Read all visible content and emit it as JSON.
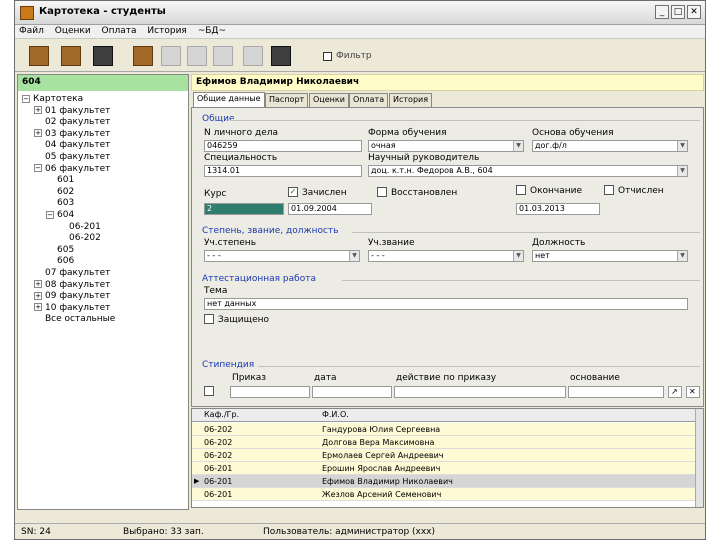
{
  "window": {
    "title": "Картотека - студенты"
  },
  "menu": [
    "Файл",
    "Оценки",
    "Оплата",
    "История",
    "~БД~"
  ],
  "toolbar": {
    "filter_label": "Фильтр"
  },
  "left": {
    "header": "604",
    "tree": [
      {
        "label": "Картотека",
        "level": 0,
        "exp": "-"
      },
      {
        "label": "01 факультет",
        "level": 1,
        "exp": "+"
      },
      {
        "label": "02 факультет",
        "level": 1,
        "exp": ""
      },
      {
        "label": "03 факультет",
        "level": 1,
        "exp": "+"
      },
      {
        "label": "04 факультет",
        "level": 1,
        "exp": ""
      },
      {
        "label": "05 факультет",
        "level": 1,
        "exp": ""
      },
      {
        "label": "06 факультет",
        "level": 1,
        "exp": "-"
      },
      {
        "label": "601",
        "level": 2,
        "exp": ""
      },
      {
        "label": "602",
        "level": 2,
        "exp": ""
      },
      {
        "label": "603",
        "level": 2,
        "exp": ""
      },
      {
        "label": "604",
        "level": 2,
        "exp": "-"
      },
      {
        "label": "06-201",
        "level": 3,
        "exp": ""
      },
      {
        "label": "06-202",
        "level": 3,
        "exp": ""
      },
      {
        "label": "605",
        "level": 2,
        "exp": ""
      },
      {
        "label": "606",
        "level": 2,
        "exp": ""
      },
      {
        "label": "07 факультет",
        "level": 1,
        "exp": ""
      },
      {
        "label": "08 факультет",
        "level": 1,
        "exp": "+"
      },
      {
        "label": "09 факультет",
        "level": 1,
        "exp": "+"
      },
      {
        "label": "10 факультет",
        "level": 1,
        "exp": "+"
      },
      {
        "label": "Все остальные",
        "level": 1,
        "exp": ""
      }
    ]
  },
  "right": {
    "header": "Ефимов Владимир Николаевич",
    "tabs": [
      "Общие данные",
      "Паспорт",
      "Оценки",
      "Оплата",
      "История"
    ],
    "sections": {
      "general": "Общие",
      "degree": "Степень, звание, должность",
      "thesis": "Аттестационная работа",
      "stipend": "Стипендия"
    },
    "labels": {
      "record_no": "N личного дела",
      "study_form": "Форма обучения",
      "study_basis": "Основа обучения",
      "specialty": "Специальность",
      "supervisor": "Научный руководитель",
      "course": "Курс",
      "enrolled": "Зачислен",
      "restored": "Восстановлен",
      "finished": "Окончание",
      "expelled": "Отчислен",
      "academic_degree": "Уч.степень",
      "academic_title": "Уч.звание",
      "position": "Должность",
      "theme": "Тема",
      "defended": "Защищено",
      "order": "Приказ",
      "date": "дата",
      "validity": "действие по приказу",
      "basis": "основание"
    },
    "values": {
      "record_no": "046259",
      "study_form": "очная",
      "study_basis": "дог.ф/л",
      "specialty": "1314.01",
      "supervisor": "доц. к.т.н. Федоров А.В., 604",
      "course": "2",
      "enrolled_date": "01.09.2004",
      "finished_date": "01.03.2013",
      "academic_degree": "- - -",
      "academic_title": "- - -",
      "position": "нет",
      "theme": "нет данных"
    },
    "grid": {
      "headers": [
        "Каф./Гр.",
        "Ф.И.О."
      ],
      "rows": [
        {
          "group": "06-202",
          "name": "Гандурова Юлия Сергеевна",
          "sel": false
        },
        {
          "group": "06-202",
          "name": "Долгова Вера Максимовна",
          "sel": false
        },
        {
          "group": "06-202",
          "name": "Ермолаев Сергей Андреевич",
          "sel": false
        },
        {
          "group": "06-201",
          "name": "Ерошин Ярослав Андреевич",
          "sel": false
        },
        {
          "group": "06-201",
          "name": "Ефимов Владимир Николаевич",
          "sel": true
        },
        {
          "group": "06-201",
          "name": "Жезлов Арсений Семенович",
          "sel": false
        }
      ]
    }
  },
  "status": {
    "sn": "SN: 24",
    "selected": "Выбрано: 33 зап.",
    "user": "Пользователь: администратор (xxx)"
  }
}
